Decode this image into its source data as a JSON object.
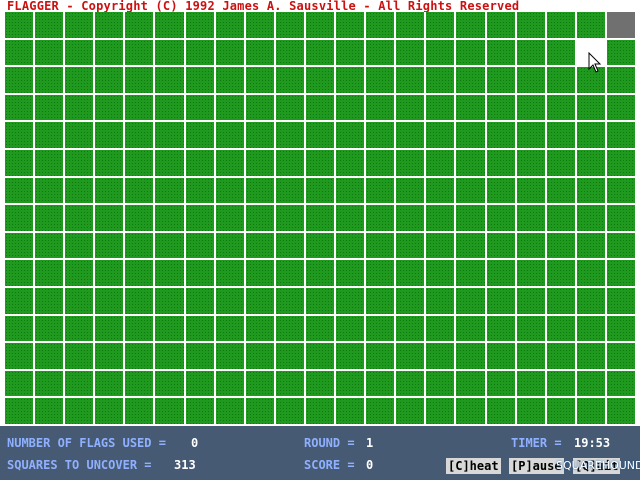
{
  "title": "FLAGGER - Copyright (C) 1992 James A. Sausville - All Rights Reserved",
  "board": {
    "columns": 21,
    "rows": 15,
    "revealed_cells": [
      {
        "row": 0,
        "col": 20,
        "state": "grey"
      }
    ],
    "highlighted_cells": [
      {
        "row": 1,
        "col": 19
      }
    ]
  },
  "status": {
    "flags_label": "NUMBER OF FLAGS USED =",
    "flags_value": "0",
    "round_label": "ROUND =",
    "round_value": "1",
    "timer_label": "TIMER =",
    "timer_value": "19:53",
    "squares_label": "SQUARES TO UNCOVER =",
    "squares_value": "313",
    "score_label": "SCORE =",
    "score_value": "0"
  },
  "keys": {
    "cheat": "[C]heat",
    "pause": "[P]ause",
    "quit": "[Q]uit"
  },
  "watermark": "SQUAREHOUND"
}
